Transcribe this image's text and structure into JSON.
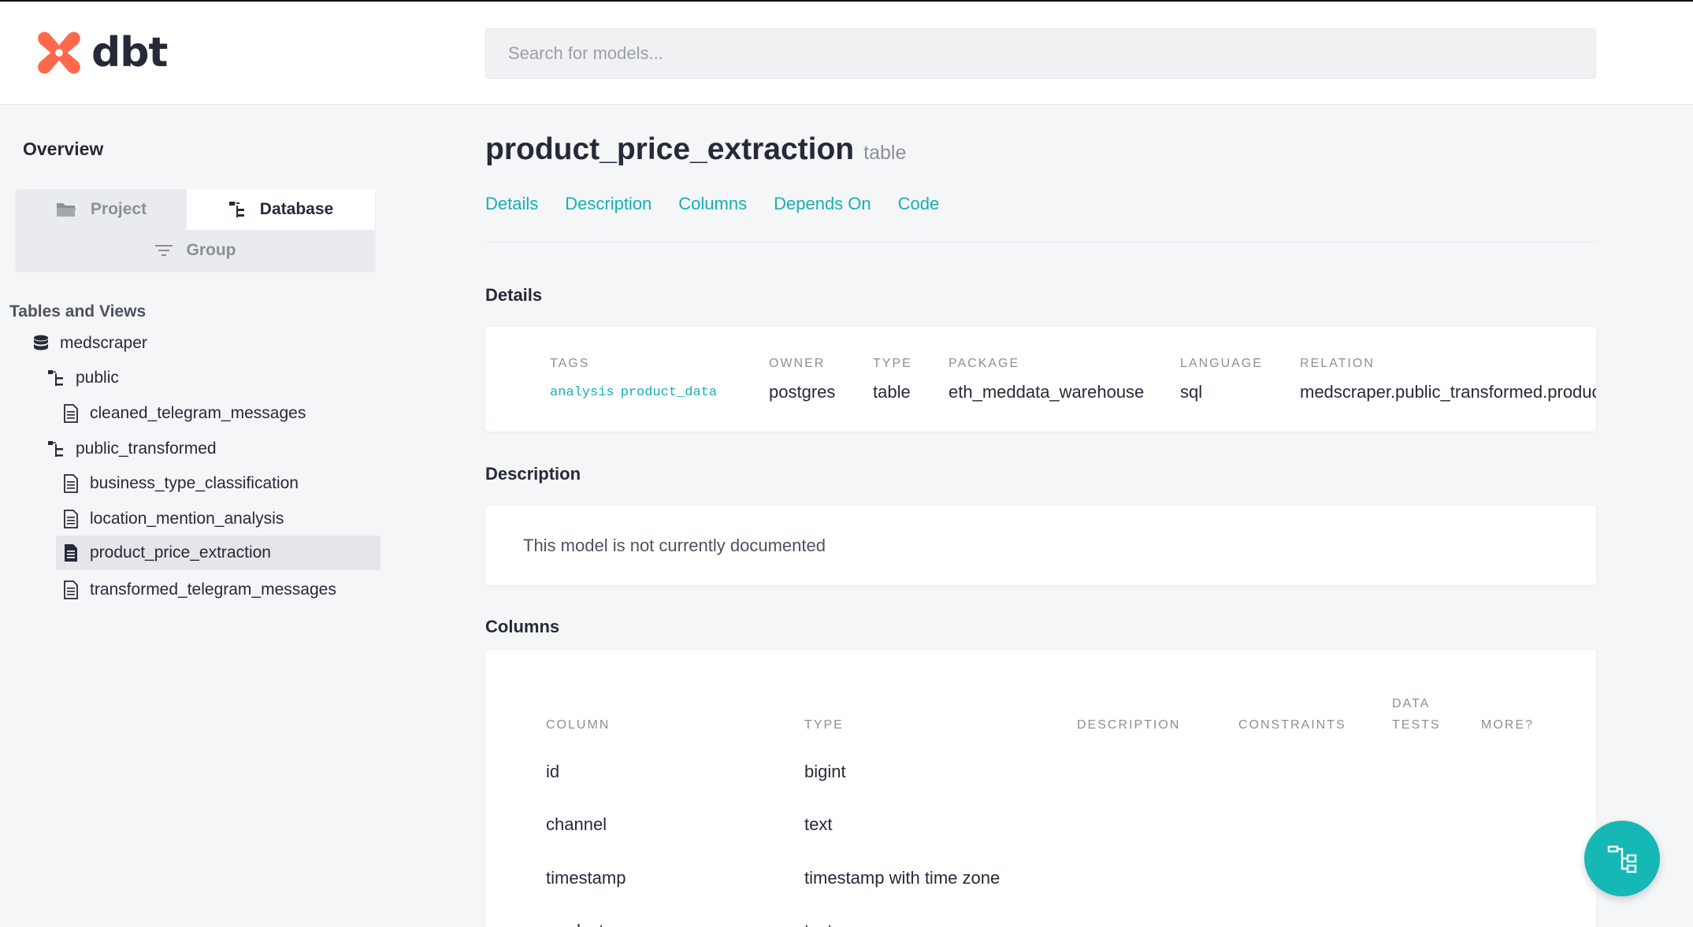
{
  "app": {
    "logo_text": "dbt",
    "brand_color": "#ff694b",
    "accent_color": "#14b0b6"
  },
  "search": {
    "placeholder": "Search for models..."
  },
  "sidebar": {
    "overview_label": "Overview",
    "switcher": {
      "project_label": "Project",
      "database_label": "Database",
      "group_label": "Group",
      "active": "Database"
    },
    "tables_heading": "Tables and Views",
    "tree": {
      "database": "medscraper",
      "schemas": [
        {
          "name": "public",
          "items": [
            "cleaned_telegram_messages"
          ]
        },
        {
          "name": "public_transformed",
          "items": [
            "business_type_classification",
            "location_mention_analysis",
            "product_price_extraction",
            "transformed_telegram_messages"
          ]
        }
      ],
      "selected": "product_price_extraction"
    }
  },
  "main": {
    "title": "product_price_extraction",
    "kind": "table",
    "tabs": [
      "Details",
      "Description",
      "Columns",
      "Depends On",
      "Code"
    ],
    "details": {
      "heading": "Details",
      "tags_label": "TAGS",
      "tags": [
        "analysis",
        "product_data"
      ],
      "owner_label": "OWNER",
      "owner": "postgres",
      "type_label": "TYPE",
      "type": "table",
      "package_label": "PACKAGE",
      "package": "eth_meddata_warehouse",
      "language_label": "LANGUAGE",
      "language": "sql",
      "relation_label": "RELATION",
      "relation": "medscraper.public_transformed.product_price_extraction"
    },
    "description": {
      "heading": "Description",
      "text": "This model is not currently documented"
    },
    "columns": {
      "heading": "Columns",
      "headers": {
        "column": "COLUMN",
        "type": "TYPE",
        "description": "DESCRIPTION",
        "constraints": "CONSTRAINTS",
        "data_tests_1": "DATA",
        "data_tests_2": "TESTS",
        "more": "MORE?"
      },
      "rows": [
        {
          "name": "id",
          "type": "bigint"
        },
        {
          "name": "channel",
          "type": "text"
        },
        {
          "name": "timestamp",
          "type": "timestamp with time zone"
        },
        {
          "name": "product_name",
          "type": "text"
        }
      ]
    }
  }
}
